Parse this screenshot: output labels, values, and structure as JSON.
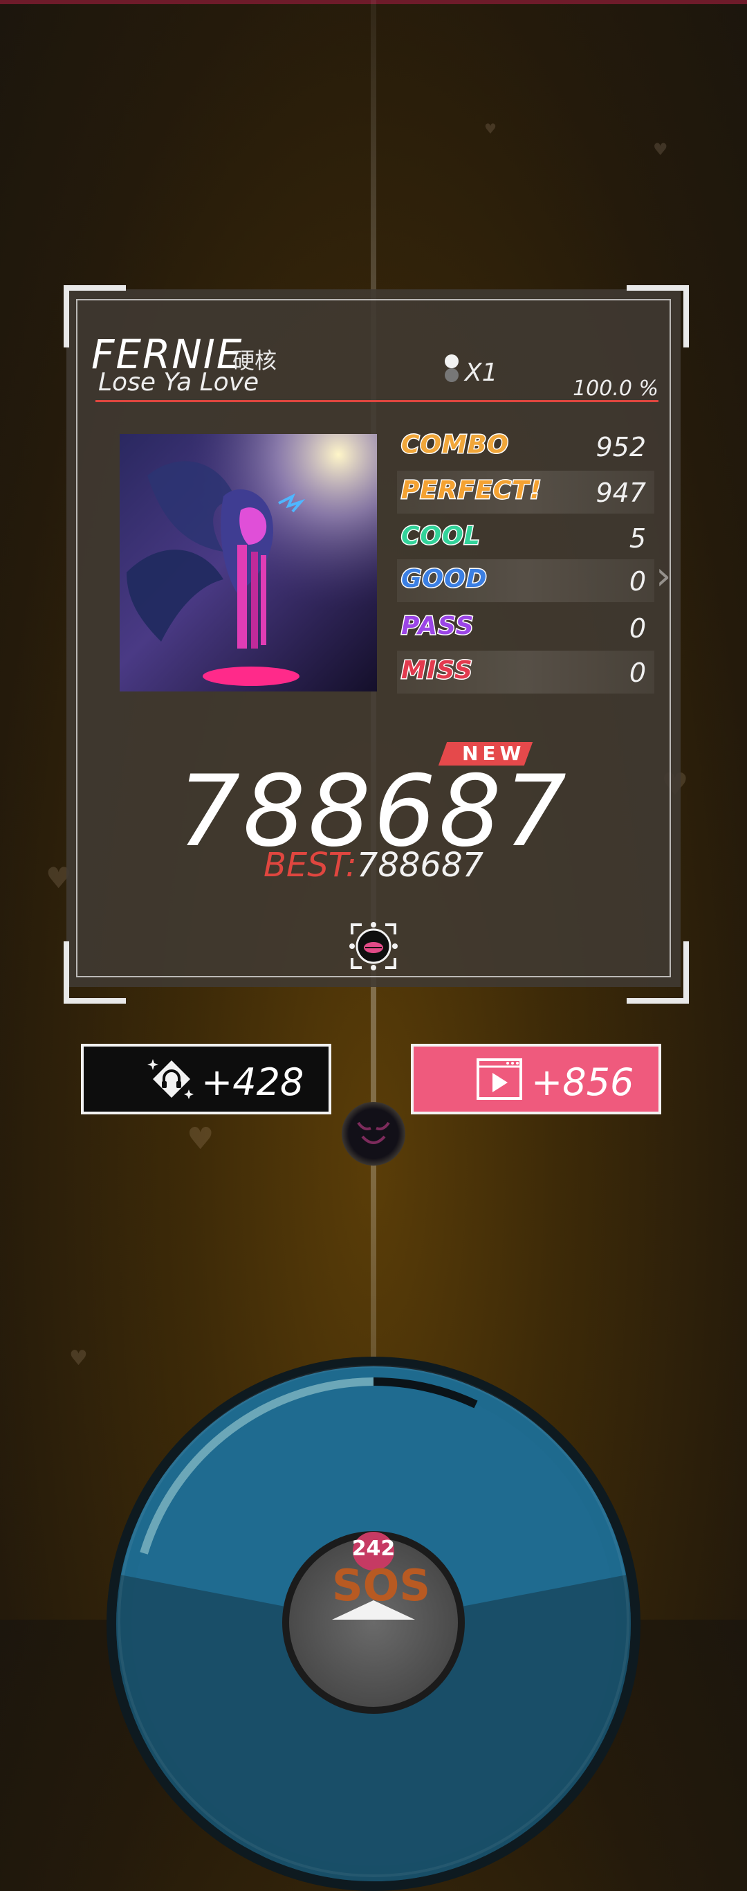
{
  "song": {
    "artist": "FERNIE",
    "genre": "硬核",
    "title": "Lose Ya Love",
    "speed": "X1",
    "accuracy": "100.0 %"
  },
  "stats": [
    {
      "label": "COMBO",
      "value": "952",
      "color": "#f0a63a"
    },
    {
      "label": "PERFECT!",
      "value": "947",
      "color": "#f4a232"
    },
    {
      "label": "COOL",
      "value": "5",
      "color": "#33d39a"
    },
    {
      "label": "GOOD",
      "value": "0",
      "color": "#3b7fe3"
    },
    {
      "label": "PASS",
      "value": "0",
      "color": "#9b45e6"
    },
    {
      "label": "MISS",
      "value": "0",
      "color": "#e23a4e"
    }
  ],
  "result": {
    "new_label": "NEW",
    "score": "788687",
    "best_label": "BEST:",
    "best_value": "788687"
  },
  "rewards": {
    "coins": "+428",
    "video_bonus": "+856"
  },
  "sos": {
    "count": "242",
    "label": "SOS"
  },
  "colors": {
    "accent_red": "#e0463f",
    "pink_button": "#ef5a7d",
    "arc_blue": "#1e6a8e"
  },
  "icons": [
    "speed-note-icon",
    "share-icon",
    "headphone-coin-icon",
    "video-play-icon",
    "demon-avatar-icon",
    "next-arrow-icon"
  ]
}
